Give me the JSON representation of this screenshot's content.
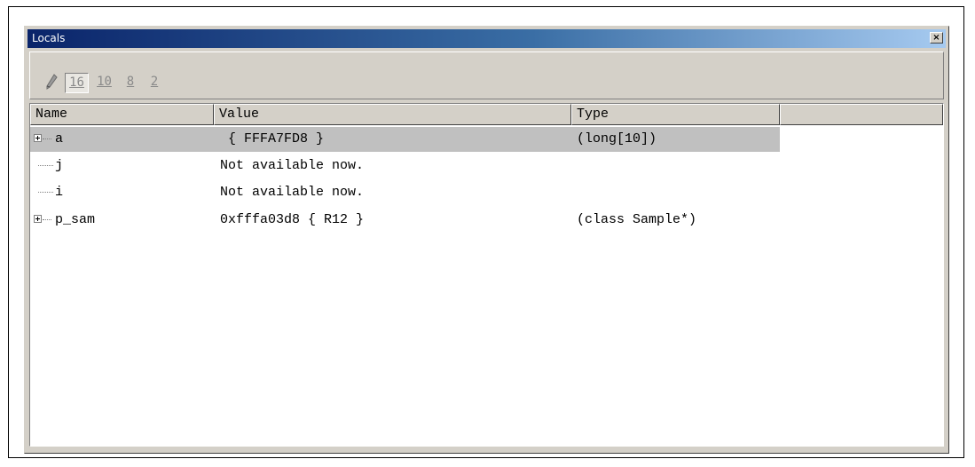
{
  "window": {
    "title": "Locals",
    "close_label": "×"
  },
  "toolbar": {
    "buttons": [
      {
        "name": "pencil",
        "icon": "pencil-icon"
      },
      {
        "label": "16",
        "pressed": true
      },
      {
        "label": "10",
        "pressed": false
      },
      {
        "label": "8",
        "pressed": false
      },
      {
        "label": "2",
        "pressed": false
      }
    ]
  },
  "grid": {
    "columns": [
      "Name",
      "Value",
      "Type"
    ],
    "rows": [
      {
        "name": "a",
        "value": "{ FFFA7FD8 }",
        "type": "(long[10])",
        "expandable": true,
        "selected": true
      },
      {
        "name": "j",
        "value": "Not available now.",
        "type": "",
        "expandable": false,
        "selected": false
      },
      {
        "name": "i",
        "value": "Not available now.",
        "type": "",
        "expandable": false,
        "selected": false
      },
      {
        "name": "p_sam",
        "value": "0xfffa03d8 { R12 }",
        "type": "(class Sample*)",
        "expandable": true,
        "selected": false
      }
    ]
  },
  "colors": {
    "title_start": "#0a246a",
    "title_end": "#a6caf0",
    "face": "#d4d0c8",
    "selection": "#c0c0c0"
  }
}
